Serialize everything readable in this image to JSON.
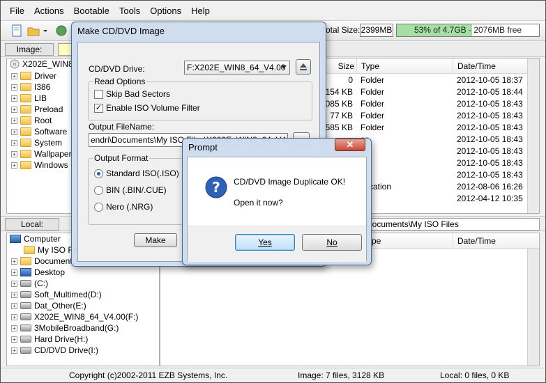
{
  "menu": [
    "File",
    "Actions",
    "Bootable",
    "Tools",
    "Options",
    "Help"
  ],
  "toolbar": {
    "total_size_label": "Total Size:",
    "total_size_value": "2399MB",
    "capacity_text": "53% of 4.7GB - 2076MB free",
    "capacity_percent": 53
  },
  "image_bar": {
    "label": "Image:"
  },
  "image_tree": {
    "root": "X202E_WIN8",
    "folders": [
      "Driver",
      "I386",
      "LIB",
      "Preload",
      "Root",
      "Software",
      "System",
      "Wallpaper",
      "Windows"
    ]
  },
  "image_list": {
    "headers": {
      "size": "Size",
      "type": "Type",
      "datetime": "Date/Time"
    },
    "rows": [
      {
        "size": "0",
        "type": "Folder",
        "date": "2012-10-05 18:37"
      },
      {
        "size": ",154 KB",
        "type": "Folder",
        "date": "2012-10-05 18:44"
      },
      {
        "size": ",085 KB",
        "type": "Folder",
        "date": "2012-10-05 18:43"
      },
      {
        "size": "77 KB",
        "type": "Folder",
        "date": "2012-10-05 18:43"
      },
      {
        "size": ",585 KB",
        "type": "Folder",
        "date": "2012-10-05 18:43"
      },
      {
        "size": "",
        "type": "er",
        "date": "2012-10-05 18:43"
      },
      {
        "size": "",
        "type": "er",
        "date": "2012-10-05 18:43"
      },
      {
        "size": "",
        "type": "er",
        "date": "2012-10-05 18:43"
      },
      {
        "size": "",
        "type": "er",
        "date": "2012-10-05 18:43"
      },
      {
        "size": "",
        "type": "plication",
        "date": "2012-08-06 16:26"
      },
      {
        "size": "",
        "type": "n",
        "date": "2012-04-12 10:35"
      }
    ]
  },
  "local_bar": {
    "label": "Local:",
    "path": "Documents\\My ISO Files"
  },
  "local_tree": [
    {
      "label": "Computer",
      "icon": "computer-icon"
    },
    {
      "label": "My ISO Fil",
      "icon": "folder-icon"
    },
    {
      "label": "Document",
      "icon": "folder-icon"
    },
    {
      "label": "Desktop",
      "icon": "desktop-icon"
    },
    {
      "label": "(C:)",
      "icon": "drive-icon"
    },
    {
      "label": "Soft_Multimed(D:)",
      "icon": "drive-icon"
    },
    {
      "label": "Dat_Other(E:)",
      "icon": "drive-icon"
    },
    {
      "label": "X202E_WIN8_64_V4.00(F:)",
      "icon": "cd-drive-icon"
    },
    {
      "label": "3MobileBroadband(G:)",
      "icon": "cd-drive-icon"
    },
    {
      "label": "Hard Drive(H:)",
      "icon": "drive-icon"
    },
    {
      "label": "CD/DVD Drive(I:)",
      "icon": "cd-drive-icon"
    }
  ],
  "local_list": {
    "headers": {
      "type": "pe",
      "datetime": "Date/Time"
    }
  },
  "status": {
    "copyright": "Copyright (c)2002-2011 EZB Systems, Inc.",
    "image": "Image: 7 files, 3128 KB",
    "local": "Local: 0 files, 0 KB"
  },
  "make_dialog": {
    "title": "Make CD/DVD Image",
    "drive_label": "CD/DVD Drive:",
    "drive_value": "F:X202E_WIN8_64_V4.00",
    "read_options_label": "Read Options",
    "skip_bad_sectors": "Skip Bad Sectors",
    "enable_iso_filter": "Enable ISO Volume Filter",
    "output_filename_label": "Output FileName:",
    "output_filename_value": "endri\\Documents\\My ISO Files\\X202E_WIN8_64_V4.00.iso",
    "output_format_label": "Output Format",
    "formats": [
      "Standard ISO(.ISO)",
      "BIN (.BIN/.CUE)",
      "Nero (.NRG)"
    ],
    "make_button": "Make"
  },
  "prompt": {
    "title": "Prompt",
    "message": "CD/DVD Image Duplicate OK!",
    "question": "Open it now?",
    "yes": "Yes",
    "no": "No"
  },
  "colors": {
    "capacity_fill": "#a6dfa6",
    "dialog_frame": "#cddcee",
    "accent": "#3c7fb1"
  }
}
